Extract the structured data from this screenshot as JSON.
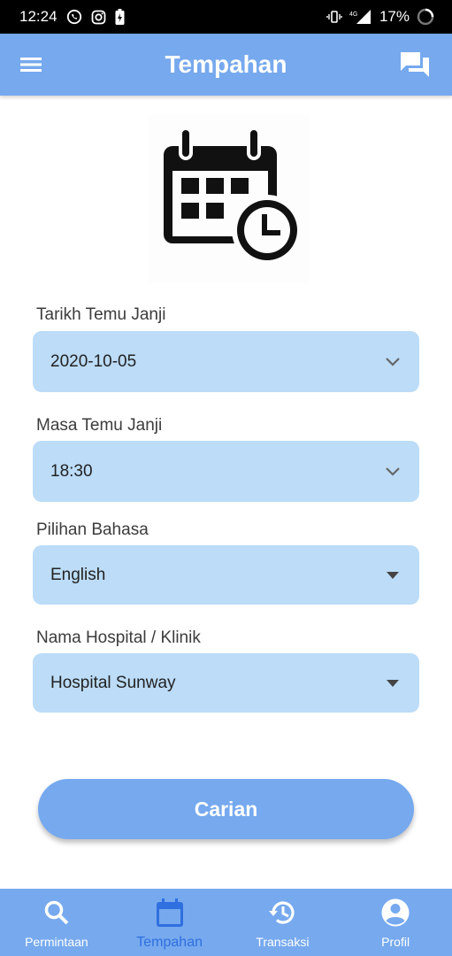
{
  "status_bar": {
    "time": "12:24",
    "battery": "17%",
    "network": "4G"
  },
  "app_bar": {
    "title": "Tempahan",
    "menu_icon": "hamburger-menu-icon",
    "chat_icon": "chat-icon"
  },
  "hero": {
    "icon": "calendar-clock-icon"
  },
  "form": {
    "date": {
      "label": "Tarikh Temu Janji",
      "value": "2020-10-05"
    },
    "time": {
      "label": "Masa Temu Janji",
      "value": "18:30"
    },
    "language": {
      "label": "Pilihan Bahasa",
      "value": "English"
    },
    "hospital": {
      "label": "Nama Hospital / Klinik",
      "value": "Hospital Sunway"
    }
  },
  "search_button": {
    "label": "Carian"
  },
  "bottom_nav": {
    "items": [
      {
        "label": "Permintaan",
        "icon": "search-icon"
      },
      {
        "label": "Tempahan",
        "icon": "calendar-icon",
        "active": true
      },
      {
        "label": "Transaksi",
        "icon": "history-icon"
      },
      {
        "label": "Profil",
        "icon": "account-circle-icon"
      }
    ]
  },
  "colors": {
    "primary": "#76a9ee",
    "field_bg": "#bcdcf8",
    "active_nav": "#2f6fe0"
  }
}
